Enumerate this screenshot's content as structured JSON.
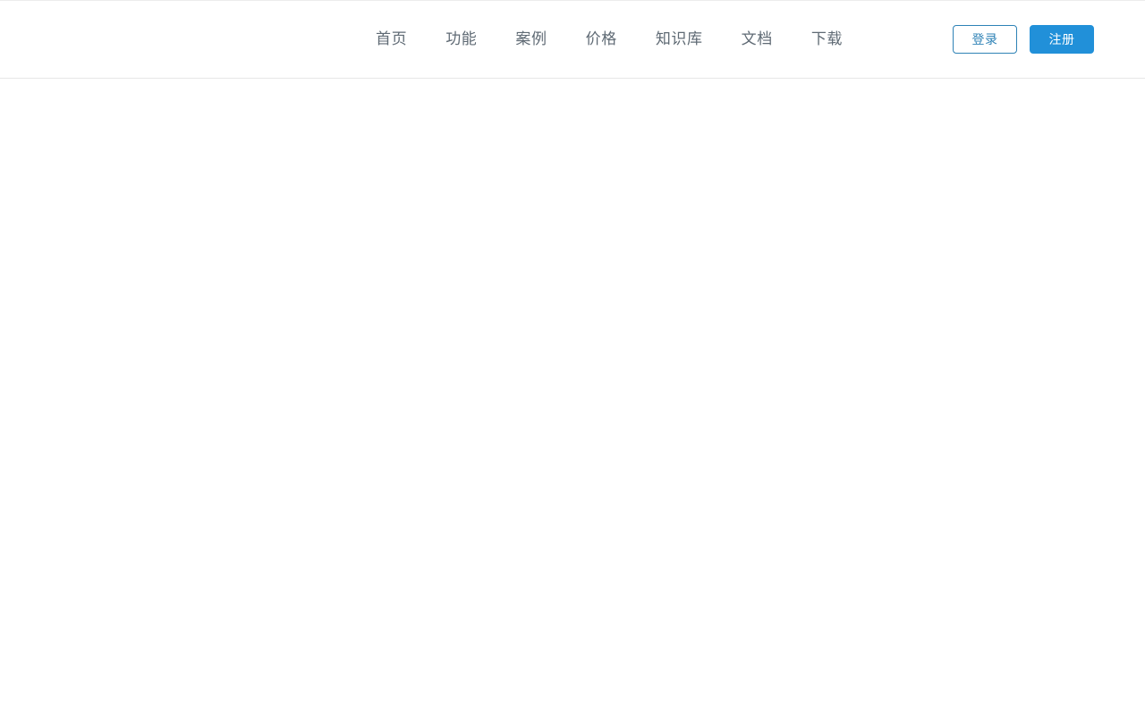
{
  "header": {
    "brand": {
      "logo_alt": ""
    },
    "nav": {
      "items": [
        {
          "label": "首页"
        },
        {
          "label": "功能"
        },
        {
          "label": "案例"
        },
        {
          "label": "价格"
        },
        {
          "label": "知识库"
        },
        {
          "label": "文档"
        },
        {
          "label": "下载"
        }
      ]
    },
    "auth": {
      "login_label": "登录",
      "register_label": "注册"
    },
    "colors": {
      "nav_text": "#5f6a74",
      "accent_blue": "#2190d9",
      "login_border": "#2e82b6",
      "login_text": "#2e82b6",
      "register_text": "#ffffff",
      "header_bg": "#ffffff",
      "header_border": "#e6e6e6",
      "header_top_border": "#ececec"
    }
  },
  "main": {
    "content": ""
  }
}
